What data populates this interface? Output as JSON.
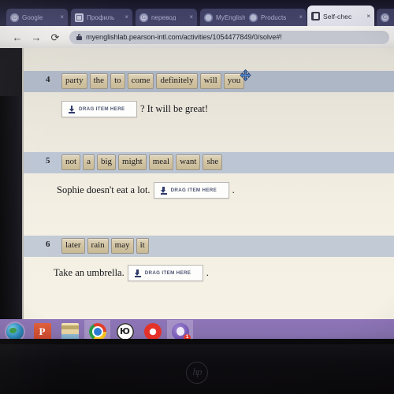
{
  "browser": {
    "tabs": [
      {
        "label": "Google",
        "favicon": "google-icon",
        "active": false
      },
      {
        "label": "Профиль",
        "favicon": "profile-icon",
        "active": false
      },
      {
        "label": "перевод",
        "favicon": "google-icon",
        "active": false
      },
      {
        "label": "MyEnglish",
        "favicon": "pearson-icon",
        "active": false
      },
      {
        "label": "Products",
        "favicon": "pearson-icon",
        "active": false
      },
      {
        "label": "Self-chec",
        "favicon": "myenglishlab-icon",
        "active": true
      },
      {
        "label": "",
        "favicon": "google-icon",
        "active": false
      }
    ],
    "close_glyph": "×",
    "nav": {
      "back": "←",
      "forward": "→",
      "reload": "⟳"
    },
    "url": "myenglishlab.pearson-intl.com/activities/1054477849/0/solve#!",
    "lock_icon": "lock-icon"
  },
  "activity": {
    "questions": [
      {
        "number": "4",
        "tiles": [
          "party",
          "the",
          "to",
          "come",
          "definitely",
          "will",
          "you"
        ],
        "answer_prefix": "",
        "dropzone_label": "DRAG ITEM HERE",
        "answer_suffix": "? It will be great!"
      },
      {
        "number": "5",
        "tiles": [
          "not",
          "a",
          "big",
          "might",
          "meal",
          "want",
          "she"
        ],
        "answer_prefix": "Sophie doesn't eat a lot.",
        "dropzone_label": "DRAG ITEM HERE",
        "answer_suffix": "."
      },
      {
        "number": "6",
        "tiles": [
          "later",
          "rain",
          "may",
          "it"
        ],
        "answer_prefix": "Take an umbrella.",
        "dropzone_label": "DRAG ITEM HERE",
        "answer_suffix": "."
      }
    ],
    "dropzone_icon": "download-arrow-icon",
    "cursor": "move-cursor"
  },
  "taskbar": {
    "items": [
      {
        "name": "start-globe",
        "icon": "globe-icon",
        "badge": ""
      },
      {
        "name": "powerpoint",
        "icon": "powerpoint-icon",
        "badge": ""
      },
      {
        "name": "file-explorer",
        "icon": "folder-icon",
        "badge": ""
      },
      {
        "name": "chrome",
        "icon": "chrome-icon",
        "badge": ""
      },
      {
        "name": "yandex-browser",
        "icon": "yandex-icon",
        "badge": ""
      },
      {
        "name": "opera",
        "icon": "opera-icon",
        "badge": ""
      },
      {
        "name": "viber",
        "icon": "viber-icon",
        "badge": "1"
      }
    ]
  },
  "device": {
    "brand_logo": "hp"
  },
  "colors": {
    "band_q4": "#aeb7c6",
    "band_q5": "#bcc5d3",
    "band_q6": "#c2cad6",
    "tile": "#d3c5a4",
    "paper": "#f3efe3",
    "taskbar": "#8872b0"
  }
}
